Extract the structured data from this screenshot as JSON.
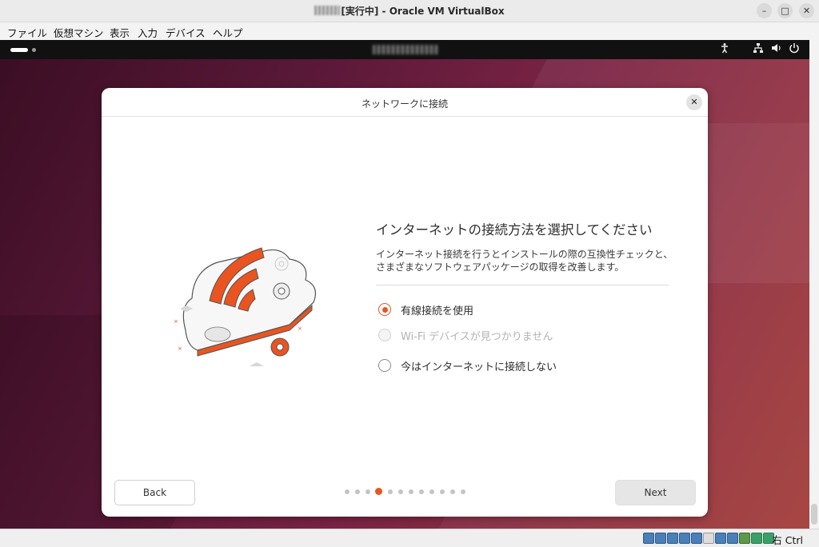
{
  "window": {
    "title": "[実行中] - Oracle VM VirtualBox",
    "controls": [
      "minimize-icon",
      "maximize-icon",
      "close-icon"
    ]
  },
  "menubar": {
    "items": [
      "ファイル",
      "仮想マシン",
      "表示",
      "入力",
      "デバイス",
      "ヘルプ"
    ]
  },
  "gnome_panel": {
    "tray_icons": [
      "accessibility-icon",
      "network-icon",
      "volume-icon",
      "power-icon"
    ]
  },
  "dialog": {
    "title": "ネットワークに接続",
    "heading": "インターネットの接続方法を選択してください",
    "description": "インターネット接続を行うとインストールの際の互換性チェックと、さまざまなソフトウェアパッケージの取得を改善します。",
    "options": [
      {
        "label": "有線接続を使用",
        "selected": true,
        "enabled": true
      },
      {
        "label": "Wi-Fi デバイスが見つかりません",
        "selected": false,
        "enabled": false
      },
      {
        "label": "今はインターネットに接続しない",
        "selected": false,
        "enabled": true
      }
    ],
    "back_label": "Back",
    "next_label": "Next",
    "progress": {
      "total_steps": 12,
      "current_step": 4
    }
  },
  "statusbar": {
    "host_key": "右 Ctrl"
  },
  "colors": {
    "accent": "#e95420",
    "desktop_dark": "#3b0e24",
    "desktop_light": "#a33c39"
  }
}
